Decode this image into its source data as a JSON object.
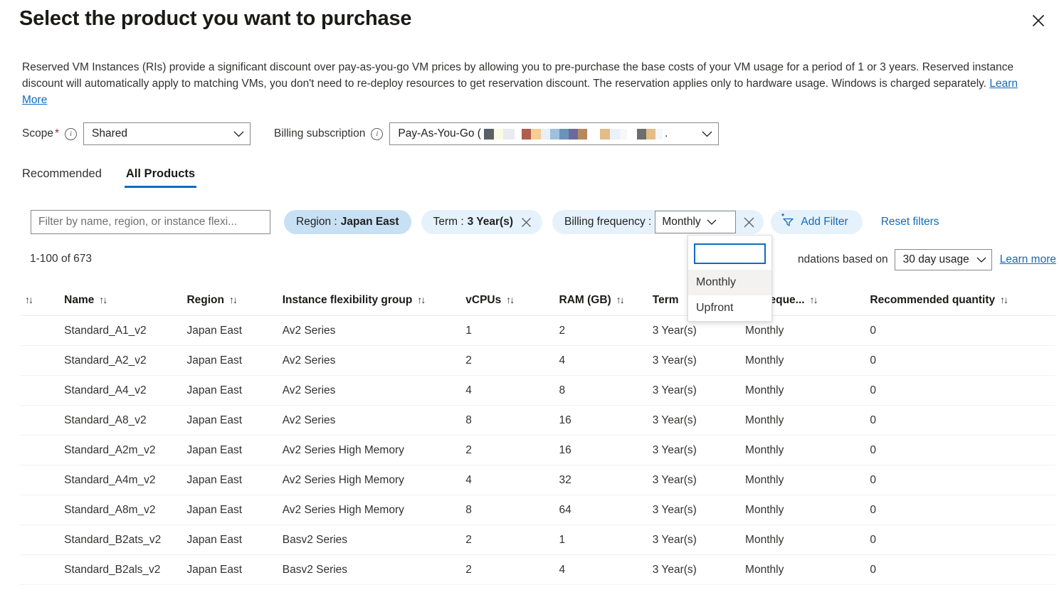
{
  "dialog": {
    "title": "Select the product you want to purchase",
    "close_icon": "close-icon",
    "description_part1": "Reserved VM Instances (RIs) provide a significant discount over pay-as-you-go VM prices by allowing you to pre-purchase the base costs of your VM usage for a period of 1 or 3 years. Reserved instance discount will automatically apply to matching VMs, you don't need to re-deploy resources to get reservation discount. The reservation applies only to hardware usage. Windows is charged separately. ",
    "description_link": "Learn More"
  },
  "controls": {
    "scope_label": "Scope",
    "scope_required": "*",
    "scope_value": "Shared",
    "billing_subscription_label": "Billing subscription",
    "billing_subscription_value": "Pay-As-You-Go (",
    "billing_subscription_suffix": ".",
    "info_glyph": "i",
    "caret_icon": "chevron-down-icon"
  },
  "tabs": [
    {
      "label": "Recommended",
      "active": false
    },
    {
      "label": "All Products",
      "active": true
    }
  ],
  "filters": {
    "search_placeholder": "Filter by name, region, or instance flexi...",
    "search_value": "",
    "region_key": "Region :",
    "region_value": "Japan East",
    "term_key": "Term :",
    "term_value": "3 Year(s)",
    "billing_key": "Billing frequency :",
    "billing_value": "Monthly",
    "add_filter_label": "Add Filter",
    "reset_label": "Reset filters",
    "remove_icon": "close-icon",
    "add_filter_icon": "add-filter-icon"
  },
  "billing_dropdown": {
    "search_value": "",
    "options": [
      {
        "label": "Monthly",
        "selected": true
      },
      {
        "label": "Upfront",
        "selected": false
      }
    ]
  },
  "results": {
    "count_text": "1-100 of 673",
    "recommendation_text": "ndations based on",
    "usage_window": "30 day usage",
    "learn_more": "Learn more"
  },
  "table": {
    "columns": [
      {
        "key": "check",
        "label": "",
        "sortable": true
      },
      {
        "key": "name",
        "label": "Name",
        "sortable": true
      },
      {
        "key": "region",
        "label": "Region",
        "sortable": true
      },
      {
        "key": "ifg",
        "label": "Instance flexibility group",
        "sortable": true
      },
      {
        "key": "vcpus",
        "label": "vCPUs",
        "sortable": true
      },
      {
        "key": "ram",
        "label": "RAM (GB)",
        "sortable": true
      },
      {
        "key": "term",
        "label": "Term",
        "sortable": false
      },
      {
        "key": "bfreq",
        "label": "ng freque...",
        "sortable": true
      },
      {
        "key": "qty",
        "label": "Recommended quantity",
        "sortable": true
      }
    ],
    "rows": [
      {
        "name": "Standard_A1_v2",
        "region": "Japan East",
        "ifg": "Av2 Series",
        "vcpus": "1",
        "ram": "2",
        "term": "3 Year(s)",
        "bfreq": "Monthly",
        "qty": "0"
      },
      {
        "name": "Standard_A2_v2",
        "region": "Japan East",
        "ifg": "Av2 Series",
        "vcpus": "2",
        "ram": "4",
        "term": "3 Year(s)",
        "bfreq": "Monthly",
        "qty": "0"
      },
      {
        "name": "Standard_A4_v2",
        "region": "Japan East",
        "ifg": "Av2 Series",
        "vcpus": "4",
        "ram": "8",
        "term": "3 Year(s)",
        "bfreq": "Monthly",
        "qty": "0"
      },
      {
        "name": "Standard_A8_v2",
        "region": "Japan East",
        "ifg": "Av2 Series",
        "vcpus": "8",
        "ram": "16",
        "term": "3 Year(s)",
        "bfreq": "Monthly",
        "qty": "0"
      },
      {
        "name": "Standard_A2m_v2",
        "region": "Japan East",
        "ifg": "Av2 Series High Memory",
        "vcpus": "2",
        "ram": "16",
        "term": "3 Year(s)",
        "bfreq": "Monthly",
        "qty": "0"
      },
      {
        "name": "Standard_A4m_v2",
        "region": "Japan East",
        "ifg": "Av2 Series High Memory",
        "vcpus": "4",
        "ram": "32",
        "term": "3 Year(s)",
        "bfreq": "Monthly",
        "qty": "0"
      },
      {
        "name": "Standard_A8m_v2",
        "region": "Japan East",
        "ifg": "Av2 Series High Memory",
        "vcpus": "8",
        "ram": "64",
        "term": "3 Year(s)",
        "bfreq": "Monthly",
        "qty": "0"
      },
      {
        "name": "Standard_B2ats_v2",
        "region": "Japan East",
        "ifg": "Basv2 Series",
        "vcpus": "2",
        "ram": "1",
        "term": "3 Year(s)",
        "bfreq": "Monthly",
        "qty": "0"
      },
      {
        "name": "Standard_B2als_v2",
        "region": "Japan East",
        "ifg": "Basv2 Series",
        "vcpus": "2",
        "ram": "4",
        "term": "3 Year(s)",
        "bfreq": "Monthly",
        "qty": "0"
      }
    ]
  },
  "redacted_blocks": [
    {
      "color": "#5a6165",
      "width": 14
    },
    {
      "color": "#fbfae6",
      "width": 13
    },
    {
      "color": "#e9eaf2",
      "width": 16
    },
    {
      "color": "#ffffff",
      "width": 10
    },
    {
      "color": "#b05c4f",
      "width": 13
    },
    {
      "color": "#f7cd93",
      "width": 14
    },
    {
      "color": "#e8eff8",
      "width": 13
    },
    {
      "color": "#9fc0dc",
      "width": 13
    },
    {
      "color": "#6b93ba",
      "width": 13
    },
    {
      "color": "#6a6aa0",
      "width": 13
    },
    {
      "color": "#b6895f",
      "width": 13
    },
    {
      "color": "#ffffff",
      "width": 18
    },
    {
      "color": "#e3bc86",
      "width": 14
    },
    {
      "color": "#eaf1fa",
      "width": 14
    },
    {
      "color": "#f5f7fb",
      "width": 10
    },
    {
      "color": "#ffffff",
      "width": 14
    },
    {
      "color": "#6e6e6e",
      "width": 13
    },
    {
      "color": "#e3bc86",
      "width": 13
    },
    {
      "color": "#f3f6fb",
      "width": 10
    }
  ],
  "colors": {
    "accent": "#0f6cbd",
    "pill_active": "#c7e0f4",
    "pill": "#e6f2fb",
    "required": "#a4262c"
  }
}
